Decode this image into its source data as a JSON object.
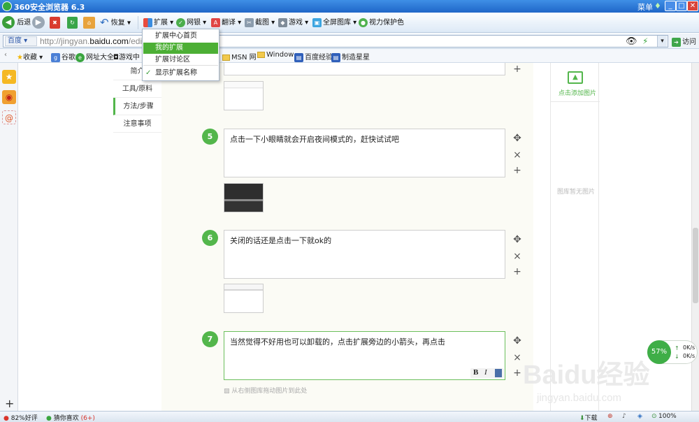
{
  "window": {
    "title": "360安全浏览器 6.3",
    "menu": "菜单"
  },
  "toolbar": {
    "back": "后退",
    "restore": "恢复",
    "extensions": "扩展",
    "bank": "网银",
    "translate": "翻译",
    "screenshot": "截图",
    "games": "游戏",
    "fullscreen_gallery": "全屏图库",
    "eye_protect": "视力保护色"
  },
  "address": {
    "engine": "百度",
    "url_prefix": "http://jingyan.",
    "url_domain": "baidu.com",
    "url_suffix": "/edi",
    "go": "访问"
  },
  "favorites": {
    "label": "收藏",
    "items": [
      "谷歌",
      "网址大全",
      "游戏中",
      "MSN 网",
      "Window",
      "百度经验",
      "制造星星"
    ]
  },
  "dropdown": {
    "items": [
      "扩展中心首页",
      "我的扩展",
      "扩展讨论区",
      "显示扩展名称"
    ],
    "selected_index": 1
  },
  "nav": {
    "items": [
      "简介",
      "工具/原料",
      "方法/步骤",
      "注意事项"
    ]
  },
  "steps": [
    {
      "num": "5",
      "text": "点击一下小眼睛就会开启夜间模式的，赶快试试吧"
    },
    {
      "num": "6",
      "text": "关闭的话还是点击一下就ok的"
    },
    {
      "num": "7",
      "text": "当然觉得不好用也可以卸载的，点击扩展旁边的小箭头，再点击"
    }
  ],
  "format_buttons": [
    "B",
    "I"
  ],
  "drag_hint": "从右侧图库拖动图片到此处",
  "right_panel": {
    "add_image": "点击添加图片",
    "empty": "图库暂无图片"
  },
  "speed": {
    "percent": "57%",
    "up": "0K/s",
    "down": "0K/s"
  },
  "watermark": {
    "brand": "Baidu经验",
    "site": "jingyan.baidu.com"
  },
  "status": {
    "rating": "82%好评",
    "guess": "猜你喜欢",
    "guess_count": "(6+)",
    "download": "下载",
    "zoom": "100%"
  },
  "colors": {
    "accent_green": "#53b64b",
    "title_blue": "#1f66c8",
    "dropdown_selected": "#4caf35"
  }
}
